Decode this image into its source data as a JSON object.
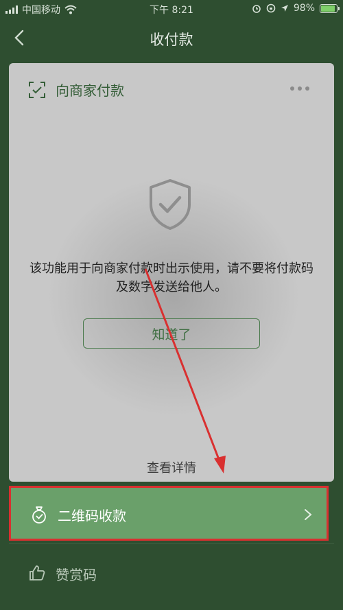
{
  "status_bar": {
    "carrier": "中国移动",
    "time": "下午 8:21",
    "battery_percent": "98%",
    "battery_level": 0.98
  },
  "nav": {
    "title": "收付款"
  },
  "card": {
    "header_label": "向商家付款",
    "notice": "该功能用于向商家付款时出示使用，请不要将付款码及数字发送给他人。",
    "ok_button": "知道了",
    "detail_link": "查看详情"
  },
  "rows": {
    "qr_collect": "二维码收款",
    "appreciation": "赞赏码"
  },
  "colors": {
    "background": "#2e4e30",
    "accent_green": "#6aa06a",
    "highlight_border": "#d93030",
    "annotation_arrow": "#d93030"
  }
}
